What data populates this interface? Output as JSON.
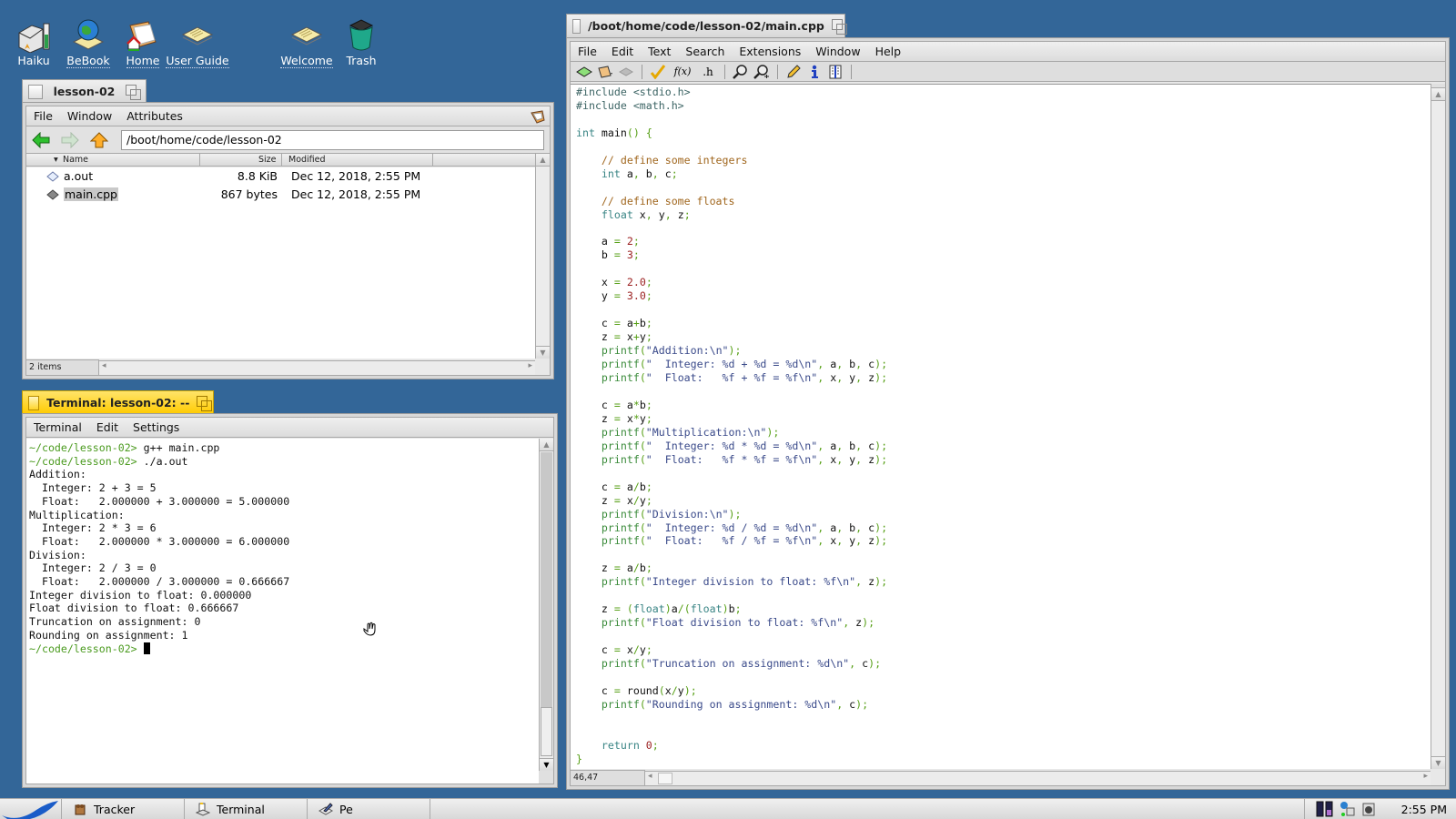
{
  "desktop": {
    "icons": [
      {
        "label": "Haiku",
        "icon": "volume-icon",
        "link": false
      },
      {
        "label": "BeBook",
        "icon": "bebook-icon",
        "link": true
      },
      {
        "label": "Home",
        "icon": "home-folder-icon",
        "link": true
      },
      {
        "label": "User Guide",
        "icon": "document-icon",
        "link": true
      },
      {
        "label": "Welcome",
        "icon": "document-icon",
        "link": true
      },
      {
        "label": "Trash",
        "icon": "trash-icon",
        "link": false
      }
    ]
  },
  "tracker": {
    "title": "lesson-02",
    "menu": [
      "File",
      "Window",
      "Attributes"
    ],
    "path": "/boot/home/code/lesson-02",
    "columns": {
      "name": "Name",
      "size": "Size",
      "modified": "Modified"
    },
    "files": [
      {
        "name": "a.out",
        "size": "8.8 KiB",
        "modified": "Dec 12, 2018, 2:55 PM",
        "selected": false
      },
      {
        "name": "main.cpp",
        "size": "867 bytes",
        "modified": "Dec 12, 2018, 2:55 PM",
        "selected": true
      }
    ],
    "status": "2 items"
  },
  "terminal": {
    "title": "Terminal: lesson-02: --",
    "menu": [
      "Terminal",
      "Edit",
      "Settings"
    ],
    "prompt": "~/code/lesson-02>",
    "lines": [
      {
        "prompt": true,
        "text": " g++ main.cpp"
      },
      {
        "prompt": true,
        "text": " ./a.out"
      },
      {
        "prompt": false,
        "text": "Addition:"
      },
      {
        "prompt": false,
        "text": "  Integer: 2 + 3 = 5"
      },
      {
        "prompt": false,
        "text": "  Float:   2.000000 + 3.000000 = 5.000000"
      },
      {
        "prompt": false,
        "text": "Multiplication:"
      },
      {
        "prompt": false,
        "text": "  Integer: 2 * 3 = 6"
      },
      {
        "prompt": false,
        "text": "  Float:   2.000000 * 3.000000 = 6.000000"
      },
      {
        "prompt": false,
        "text": "Division:"
      },
      {
        "prompt": false,
        "text": "  Integer: 2 / 3 = 0"
      },
      {
        "prompt": false,
        "text": "  Float:   2.000000 / 3.000000 = 0.666667"
      },
      {
        "prompt": false,
        "text": "Integer division to float: 0.000000"
      },
      {
        "prompt": false,
        "text": "Float division to float: 0.666667"
      },
      {
        "prompt": false,
        "text": "Truncation on assignment: 0"
      },
      {
        "prompt": false,
        "text": "Rounding on assignment: 1"
      },
      {
        "prompt": true,
        "text": " "
      }
    ]
  },
  "editor": {
    "title": "/boot/home/code/lesson-02/main.cpp",
    "menu": [
      "File",
      "Edit",
      "Text",
      "Search",
      "Extensions",
      "Window",
      "Help"
    ],
    "toolbar": [
      "new-document-icon",
      "open-folder-icon",
      "save-icon",
      "check-icon",
      "function-menu-icon",
      "header-menu-icon",
      "find-icon",
      "find-next-icon",
      "edit-pencil-icon",
      "info-icon",
      "split-view-icon"
    ],
    "toolbar_text": {
      "function": "f(x)",
      "header": ".h"
    },
    "code": [
      "#include <stdio.h>",
      "#include <math.h>",
      "",
      "int main() {",
      "",
      "    // define some integers",
      "    int a, b, c;",
      "",
      "    // define some floats",
      "    float x, y, z;",
      "",
      "    a = 2;",
      "    b = 3;",
      "",
      "    x = 2.0;",
      "    y = 3.0;",
      "",
      "    c = a+b;",
      "    z = x+y;",
      "    printf(\"Addition:\\n\");",
      "    printf(\"  Integer: %d + %d = %d\\n\", a, b, c);",
      "    printf(\"  Float:   %f + %f = %f\\n\", x, y, z);",
      "",
      "    c = a*b;",
      "    z = x*y;",
      "    printf(\"Multiplication:\\n\");",
      "    printf(\"  Integer: %d * %d = %d\\n\", a, b, c);",
      "    printf(\"  Float:   %f * %f = %f\\n\", x, y, z);",
      "",
      "    c = a/b;",
      "    z = x/y;",
      "    printf(\"Division:\\n\");",
      "    printf(\"  Integer: %d / %d = %d\\n\", a, b, c);",
      "    printf(\"  Float:   %f / %f = %f\\n\", x, y, z);",
      "",
      "    z = a/b;",
      "    printf(\"Integer division to float: %f\\n\", z);",
      "",
      "    z = (float)a/(float)b;",
      "    printf(\"Float division to float: %f\\n\", z);",
      "",
      "    c = x/y;",
      "    printf(\"Truncation on assignment: %d\\n\", c);",
      "",
      "    c = round(x/y);",
      "    printf(\"Rounding on assignment: %d\\n\", c);",
      "",
      "",
      "    return 0;",
      "}"
    ],
    "cursor_position": "46,47"
  },
  "taskbar": {
    "apps": [
      {
        "label": "Tracker",
        "icon": "tracker-icon"
      },
      {
        "label": "Terminal",
        "icon": "terminal-icon"
      },
      {
        "label": "Pe",
        "icon": "pe-editor-icon"
      }
    ],
    "clock": "2:55 PM"
  },
  "colors": {
    "desktop": "#336698",
    "active_tab": "#ffcb00",
    "prompt": "#4a9a1e"
  }
}
